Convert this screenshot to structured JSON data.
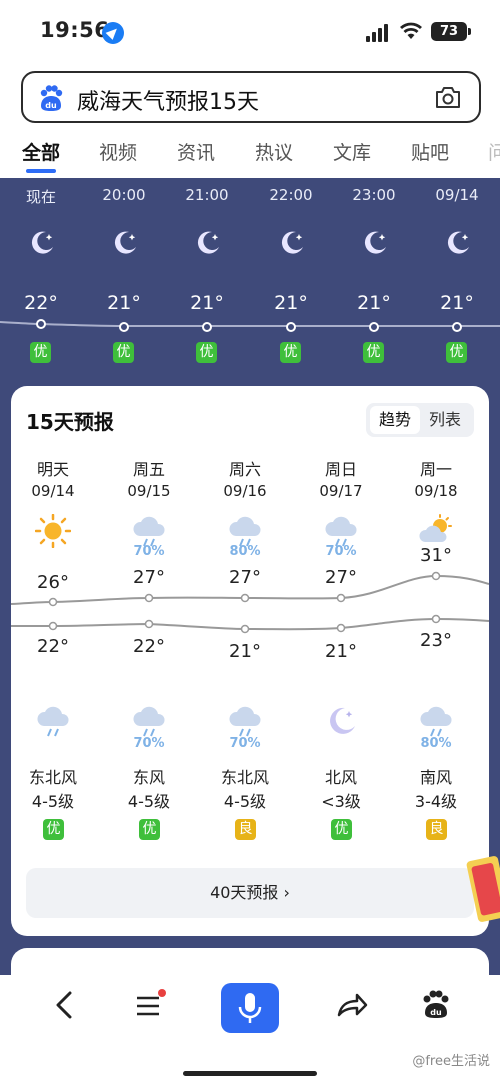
{
  "status_bar": {
    "time": "19:56",
    "battery": "73"
  },
  "search": {
    "query": "威海天气预报15天"
  },
  "tabs": [
    {
      "label": "全部",
      "active": true
    },
    {
      "label": "视频"
    },
    {
      "label": "资讯"
    },
    {
      "label": "热议"
    },
    {
      "label": "文库"
    },
    {
      "label": "贴吧"
    },
    {
      "label": "问"
    }
  ],
  "hourly": [
    {
      "time": "现在",
      "temp": "22°",
      "aqi": "优"
    },
    {
      "time": "20:00",
      "temp": "21°",
      "aqi": "优"
    },
    {
      "time": "21:00",
      "temp": "21°",
      "aqi": "优"
    },
    {
      "time": "22:00",
      "temp": "21°",
      "aqi": "优"
    },
    {
      "time": "23:00",
      "temp": "21°",
      "aqi": "优"
    },
    {
      "time": "09/14",
      "temp": "21°",
      "aqi": "优"
    }
  ],
  "forecast": {
    "title": "15天预报",
    "toggle": {
      "trend": "趋势",
      "list": "列表"
    },
    "days": [
      {
        "name": "明天",
        "date": "09/14",
        "day_icon": "sun-icon",
        "day_precip": "",
        "high": "26°",
        "low": "22°",
        "night_icon": "rain-cloud-icon",
        "night_precip": "",
        "wind_dir": "东北风",
        "wind_level": "4-5级",
        "aqi": "优",
        "aqi_level": "good"
      },
      {
        "name": "周五",
        "date": "09/15",
        "day_icon": "rain-cloud-icon",
        "day_precip": "70%",
        "high": "27°",
        "low": "22°",
        "night_icon": "rain-cloud-icon",
        "night_precip": "70%",
        "wind_dir": "东风",
        "wind_level": "4-5级",
        "aqi": "优",
        "aqi_level": "good"
      },
      {
        "name": "周六",
        "date": "09/16",
        "day_icon": "rain-cloud-icon",
        "day_precip": "80%",
        "high": "27°",
        "low": "21°",
        "night_icon": "rain-cloud-icon",
        "night_precip": "70%",
        "wind_dir": "东北风",
        "wind_level": "4-5级",
        "aqi": "良",
        "aqi_level": "fair"
      },
      {
        "name": "周日",
        "date": "09/17",
        "day_icon": "rain-cloud-icon",
        "day_precip": "70%",
        "high": "27°",
        "low": "21°",
        "night_icon": "moon-icon",
        "night_precip": "",
        "wind_dir": "北风",
        "wind_level": "<3级",
        "aqi": "优",
        "aqi_level": "good"
      },
      {
        "name": "周一",
        "date": "09/18",
        "day_icon": "partly-cloudy-icon",
        "day_precip": "",
        "high": "31°",
        "low": "23°",
        "night_icon": "rain-cloud-icon",
        "night_precip": "80%",
        "wind_dir": "南风",
        "wind_level": "3-4级",
        "aqi": "良",
        "aqi_level": "fair"
      }
    ],
    "more_label": "40天预报 ›"
  },
  "bottom_bar": {
    "icons": [
      "back-icon",
      "feed-icon",
      "mic-icon",
      "share-icon",
      "baidu-paw-icon"
    ],
    "watermark": "@free生活说"
  },
  "colors": {
    "sky": "#3f4a7a",
    "aqi_good": "#3fbf3b",
    "aqi_fair": "#e7b318",
    "accent": "#2f6af2"
  }
}
